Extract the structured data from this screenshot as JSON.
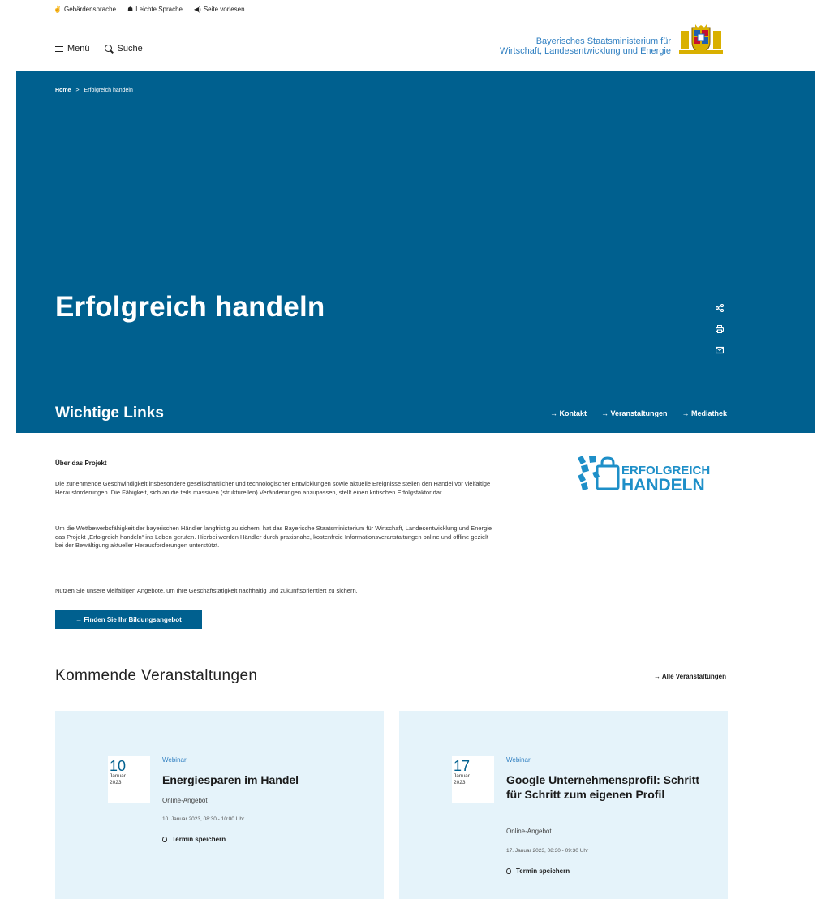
{
  "a11y": {
    "sign_language": "Gebärdensprache",
    "easy_language": "Leichte Sprache",
    "read_aloud": "Seite vorlesen"
  },
  "header": {
    "menu_label": "Menü",
    "search_label": "Suche",
    "ministry_line1": "Bayerisches Staatsministerium für",
    "ministry_line2": "Wirtschaft, Landesentwicklung und Energie"
  },
  "breadcrumb": {
    "home": "Home",
    "separator": ">",
    "current": "Erfolgreich handeln"
  },
  "hero": {
    "title": "Erfolgreich handeln",
    "links_title": "Wichtige Links",
    "links": [
      "→ Kontakt",
      "→ Veranstaltungen",
      "→ Mediathek"
    ]
  },
  "about": {
    "title": "Über das Projekt",
    "p1": "Die zunehmende Geschwindigkeit insbesondere gesellschaftlicher und technologischer Entwicklungen sowie aktuelle Ereignisse stellen den Handel vor vielfältige Herausforderungen. Die Fähigkeit, sich an die teils massiven (strukturellen) Veränderungen anzupassen, stellt einen kritischen Erfolgsfaktor dar.",
    "p2": "Um die Wettbewerbsfähigkeit der bayerischen Händler langfristig zu sichern, hat das Bayerische Staatsministerium für Wirtschaft, Landesentwicklung und Energie das Projekt „Erfolgreich handeln“ ins Leben gerufen. Hierbei werden Händler durch praxisnahe, kostenfreie Informationsveranstaltungen online und offline gezielt bei der Bewältigung aktueller Herausforderungen unterstützt.",
    "p3": "Nutzen Sie unsere vielfältigen Angebote, um Ihre Geschäftstätigkeit nachhaltig und zukunftsorientiert zu sichern.",
    "cta": "→ Finden Sie Ihr Bildungsangebot",
    "logo_line1": "ERFOLGREICH",
    "logo_line2": "HANDELN"
  },
  "events": {
    "title": "Kommende Veranstaltungen",
    "all_link": "→ Alle Veranstaltungen",
    "items": [
      {
        "day": "10",
        "month": "Januar",
        "year": "2023",
        "category": "Webinar",
        "title": "Energiesparen im Handel",
        "type": "Online-Angebot",
        "datetime": "10. Januar 2023, 08:30 - 10:00 Uhr",
        "save": "Termin speichern"
      },
      {
        "day": "17",
        "month": "Januar",
        "year": "2023",
        "category": "Webinar",
        "title": "Google Unternehmensprofil: Schritt für Schritt zum eigenen Profil",
        "type": "Online-Angebot",
        "datetime": "17. Januar 2023, 08:30 - 09:30 Uhr",
        "save": "Termin speichern"
      }
    ]
  },
  "colors": {
    "brand_blue": "#00608f",
    "link_blue": "#2f7fc1",
    "card_bg": "#e5f3fa"
  }
}
